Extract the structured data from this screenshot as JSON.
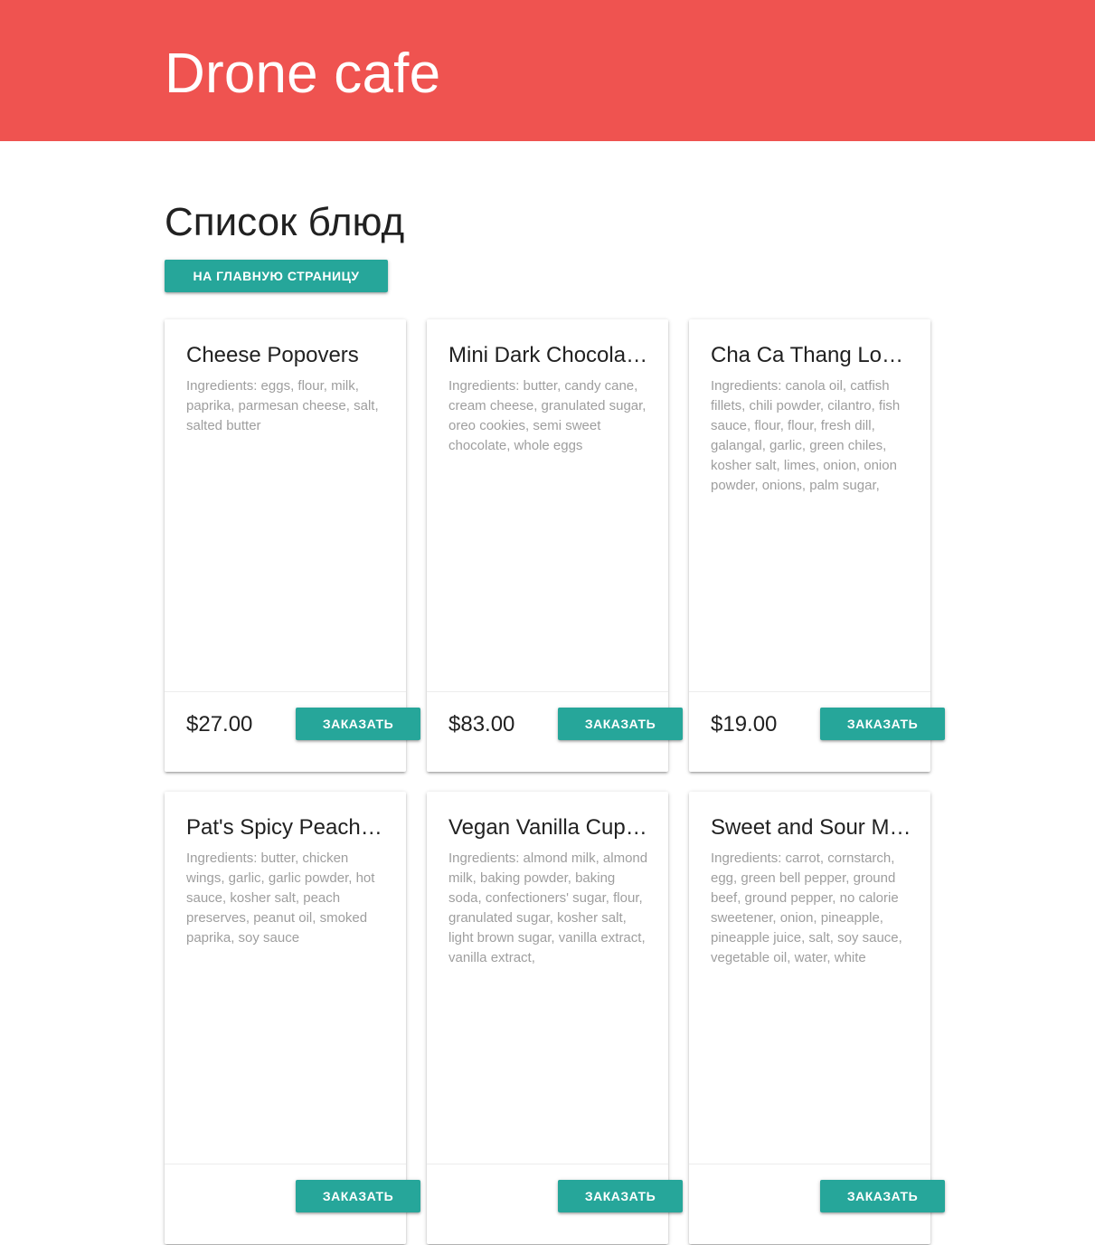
{
  "header": {
    "brand": "Drone cafe"
  },
  "page": {
    "title": "Список блюд",
    "home_button": "На главную страницу"
  },
  "colors": {
    "header_bg": "#ef5350",
    "accent": "#26a69a"
  },
  "dishes": [
    {
      "title": "Cheese Popovers",
      "ingredients": "Ingredients: eggs, flour, milk, paprika, parmesan cheese, salt, salted butter",
      "price": "$27.00",
      "order_label": "Заказать"
    },
    {
      "title": "Mini Dark Chocolate Peppermint Cheesecakes",
      "ingredients": "Ingredients: butter, candy cane, cream cheese, granulated sugar, oreo cookies, semi sweet chocolate, whole eggs",
      "price": "$83.00",
      "order_label": "Заказать"
    },
    {
      "title": "Cha Ca Thang Long (Vietnamese Fish)",
      "ingredients": "Ingredients: canola oil, catfish fillets, chili powder, cilantro, fish sauce, flour, flour, fresh dill, galangal, garlic, green chiles, kosher salt, limes, onion, onion powder, onions, palm sugar,",
      "price": "$19.00",
      "order_label": "Заказать"
    },
    {
      "title": "Pat's Spicy Peach Hot Wings",
      "ingredients": "Ingredients: butter, chicken wings, garlic, garlic powder, hot sauce, kosher salt, peach preserves, peanut oil, smoked paprika, soy sauce",
      "price": "",
      "order_label": "Заказать"
    },
    {
      "title": "Vegan Vanilla Cupcakes",
      "ingredients": "Ingredients: almond milk, almond milk, baking powder, baking soda, confectioners' sugar, flour, granulated sugar, kosher salt, light brown sugar, vanilla extract, vanilla extract,",
      "price": "",
      "order_label": "Заказать"
    },
    {
      "title": "Sweet and Sour Meatballs",
      "ingredients": "Ingredients: carrot, cornstarch, egg, green bell pepper, ground beef, ground pepper, no calorie sweetener, onion, pineapple, pineapple juice, salt, soy sauce, vegetable oil, water, white",
      "price": "",
      "order_label": "Заказать"
    }
  ]
}
